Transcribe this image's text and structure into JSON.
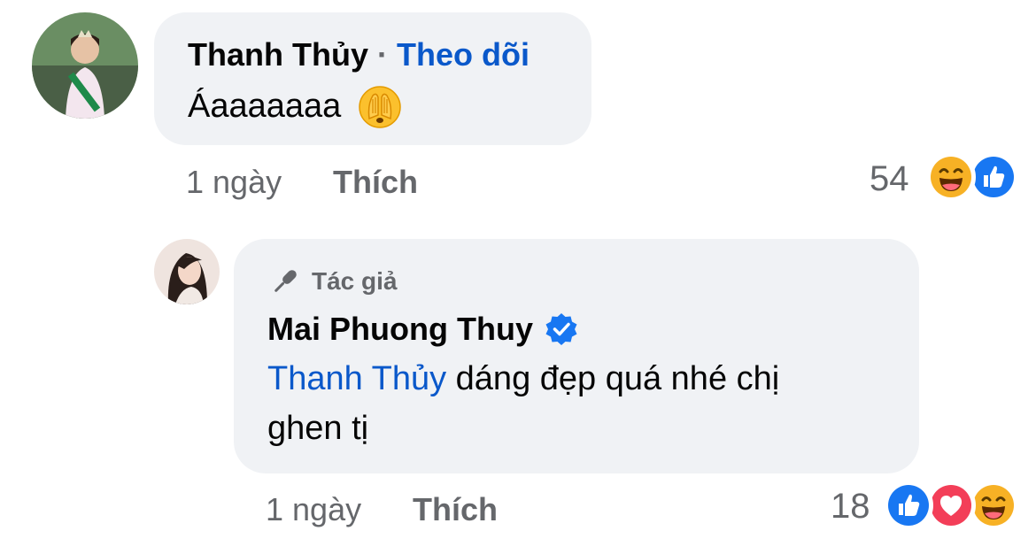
{
  "comment": {
    "author": "Thanh Thủy",
    "separator": "·",
    "follow_label": "Theo dõi",
    "text": "Áaaaaaaa",
    "emoji_icon": "see-no-evil-face-emoji",
    "time": "1 ngày",
    "like_label": "Thích",
    "reaction_count": "54",
    "reactions": [
      "haha",
      "like"
    ]
  },
  "reply": {
    "badge_label": "Tác giả",
    "badge_icon": "microphone-icon",
    "author": "Mai Phuong Thuy",
    "verified_icon": "verified-badge-icon",
    "mention": "Thanh Thủy",
    "text_line1": " dáng đẹp quá nhé chị",
    "text_line2": "ghen tị",
    "time": "1 ngày",
    "like_label": "Thích",
    "reaction_count": "18",
    "reactions": [
      "like",
      "love",
      "haha"
    ]
  },
  "colors": {
    "bubble": "#f0f2f5",
    "link": "#0a58ca",
    "muted": "#65676b",
    "like_blue": "#1877f2",
    "love_red": "#f33e58",
    "haha_yellow": "#f7b125"
  }
}
